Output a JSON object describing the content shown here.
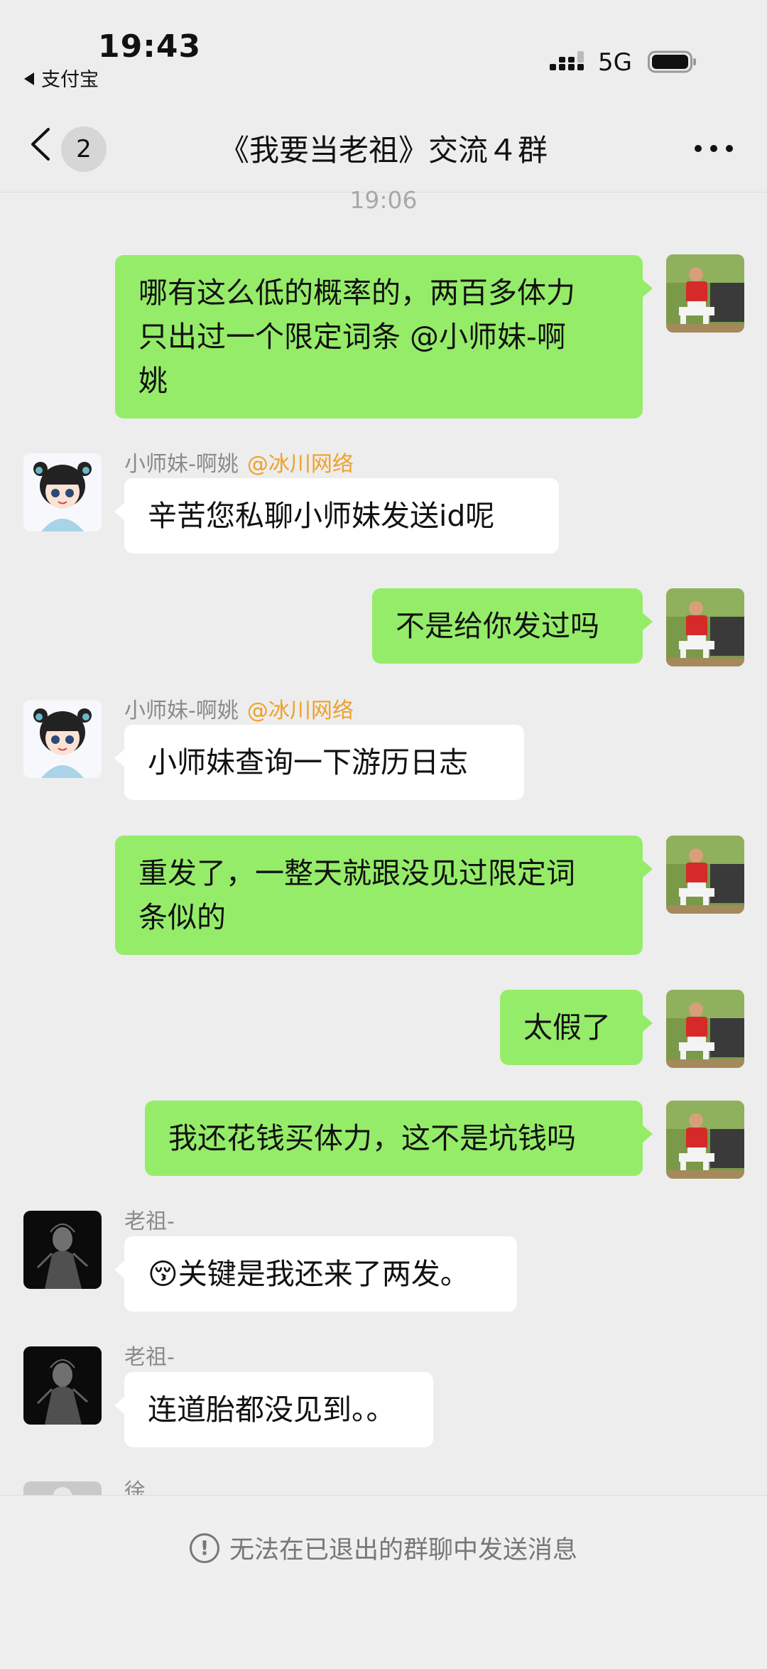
{
  "status_bar": {
    "time": "19:43",
    "back_app": "支付宝",
    "network": "5G",
    "icons": [
      "signal-icon",
      "battery-icon"
    ]
  },
  "nav": {
    "unread_count": "2",
    "title": "《我要当老祖》交流４群",
    "icons": [
      "back-chevron-icon",
      "more-dots-icon"
    ]
  },
  "timestamp": "19:06",
  "messages": [
    {
      "side": "me",
      "lines": [
        "哪有这么低的概率的，两百多体力",
        "只出过一个限定词条 @小师妹-啊",
        "姚"
      ]
    },
    {
      "side": "them",
      "sender": "小师妹-啊姚",
      "mention": "@冰川网络",
      "lines": [
        "辛苦您私聊小师妹发送id呢"
      ]
    },
    {
      "side": "me",
      "lines": [
        "不是给你发过吗"
      ]
    },
    {
      "side": "them",
      "sender": "小师妹-啊姚",
      "mention": "@冰川网络",
      "lines": [
        "小师妹查询一下游历日志"
      ]
    },
    {
      "side": "me",
      "lines": [
        "重发了，一整天就跟没见过限定词",
        "条似的"
      ]
    },
    {
      "side": "me",
      "lines": [
        "太假了"
      ]
    },
    {
      "side": "me",
      "lines": [
        "我还花钱买体力，这不是坑钱吗"
      ]
    },
    {
      "side": "them",
      "sender": "老祖-",
      "emoji": "😚",
      "lines": [
        "关键是我还来了两发。"
      ]
    },
    {
      "side": "them",
      "sender": "老祖-",
      "lines": [
        "连道胎都没见到。。"
      ]
    },
    {
      "side": "them",
      "sender": "徐"
    }
  ],
  "footer": {
    "notice": "无法在已退出的群聊中发送消息",
    "icon": "exclamation-circle-icon"
  },
  "colors": {
    "background": "#ededed",
    "my_bubble": "#95ec69",
    "their_bubble": "#ffffff",
    "mention": "#f0a028"
  }
}
